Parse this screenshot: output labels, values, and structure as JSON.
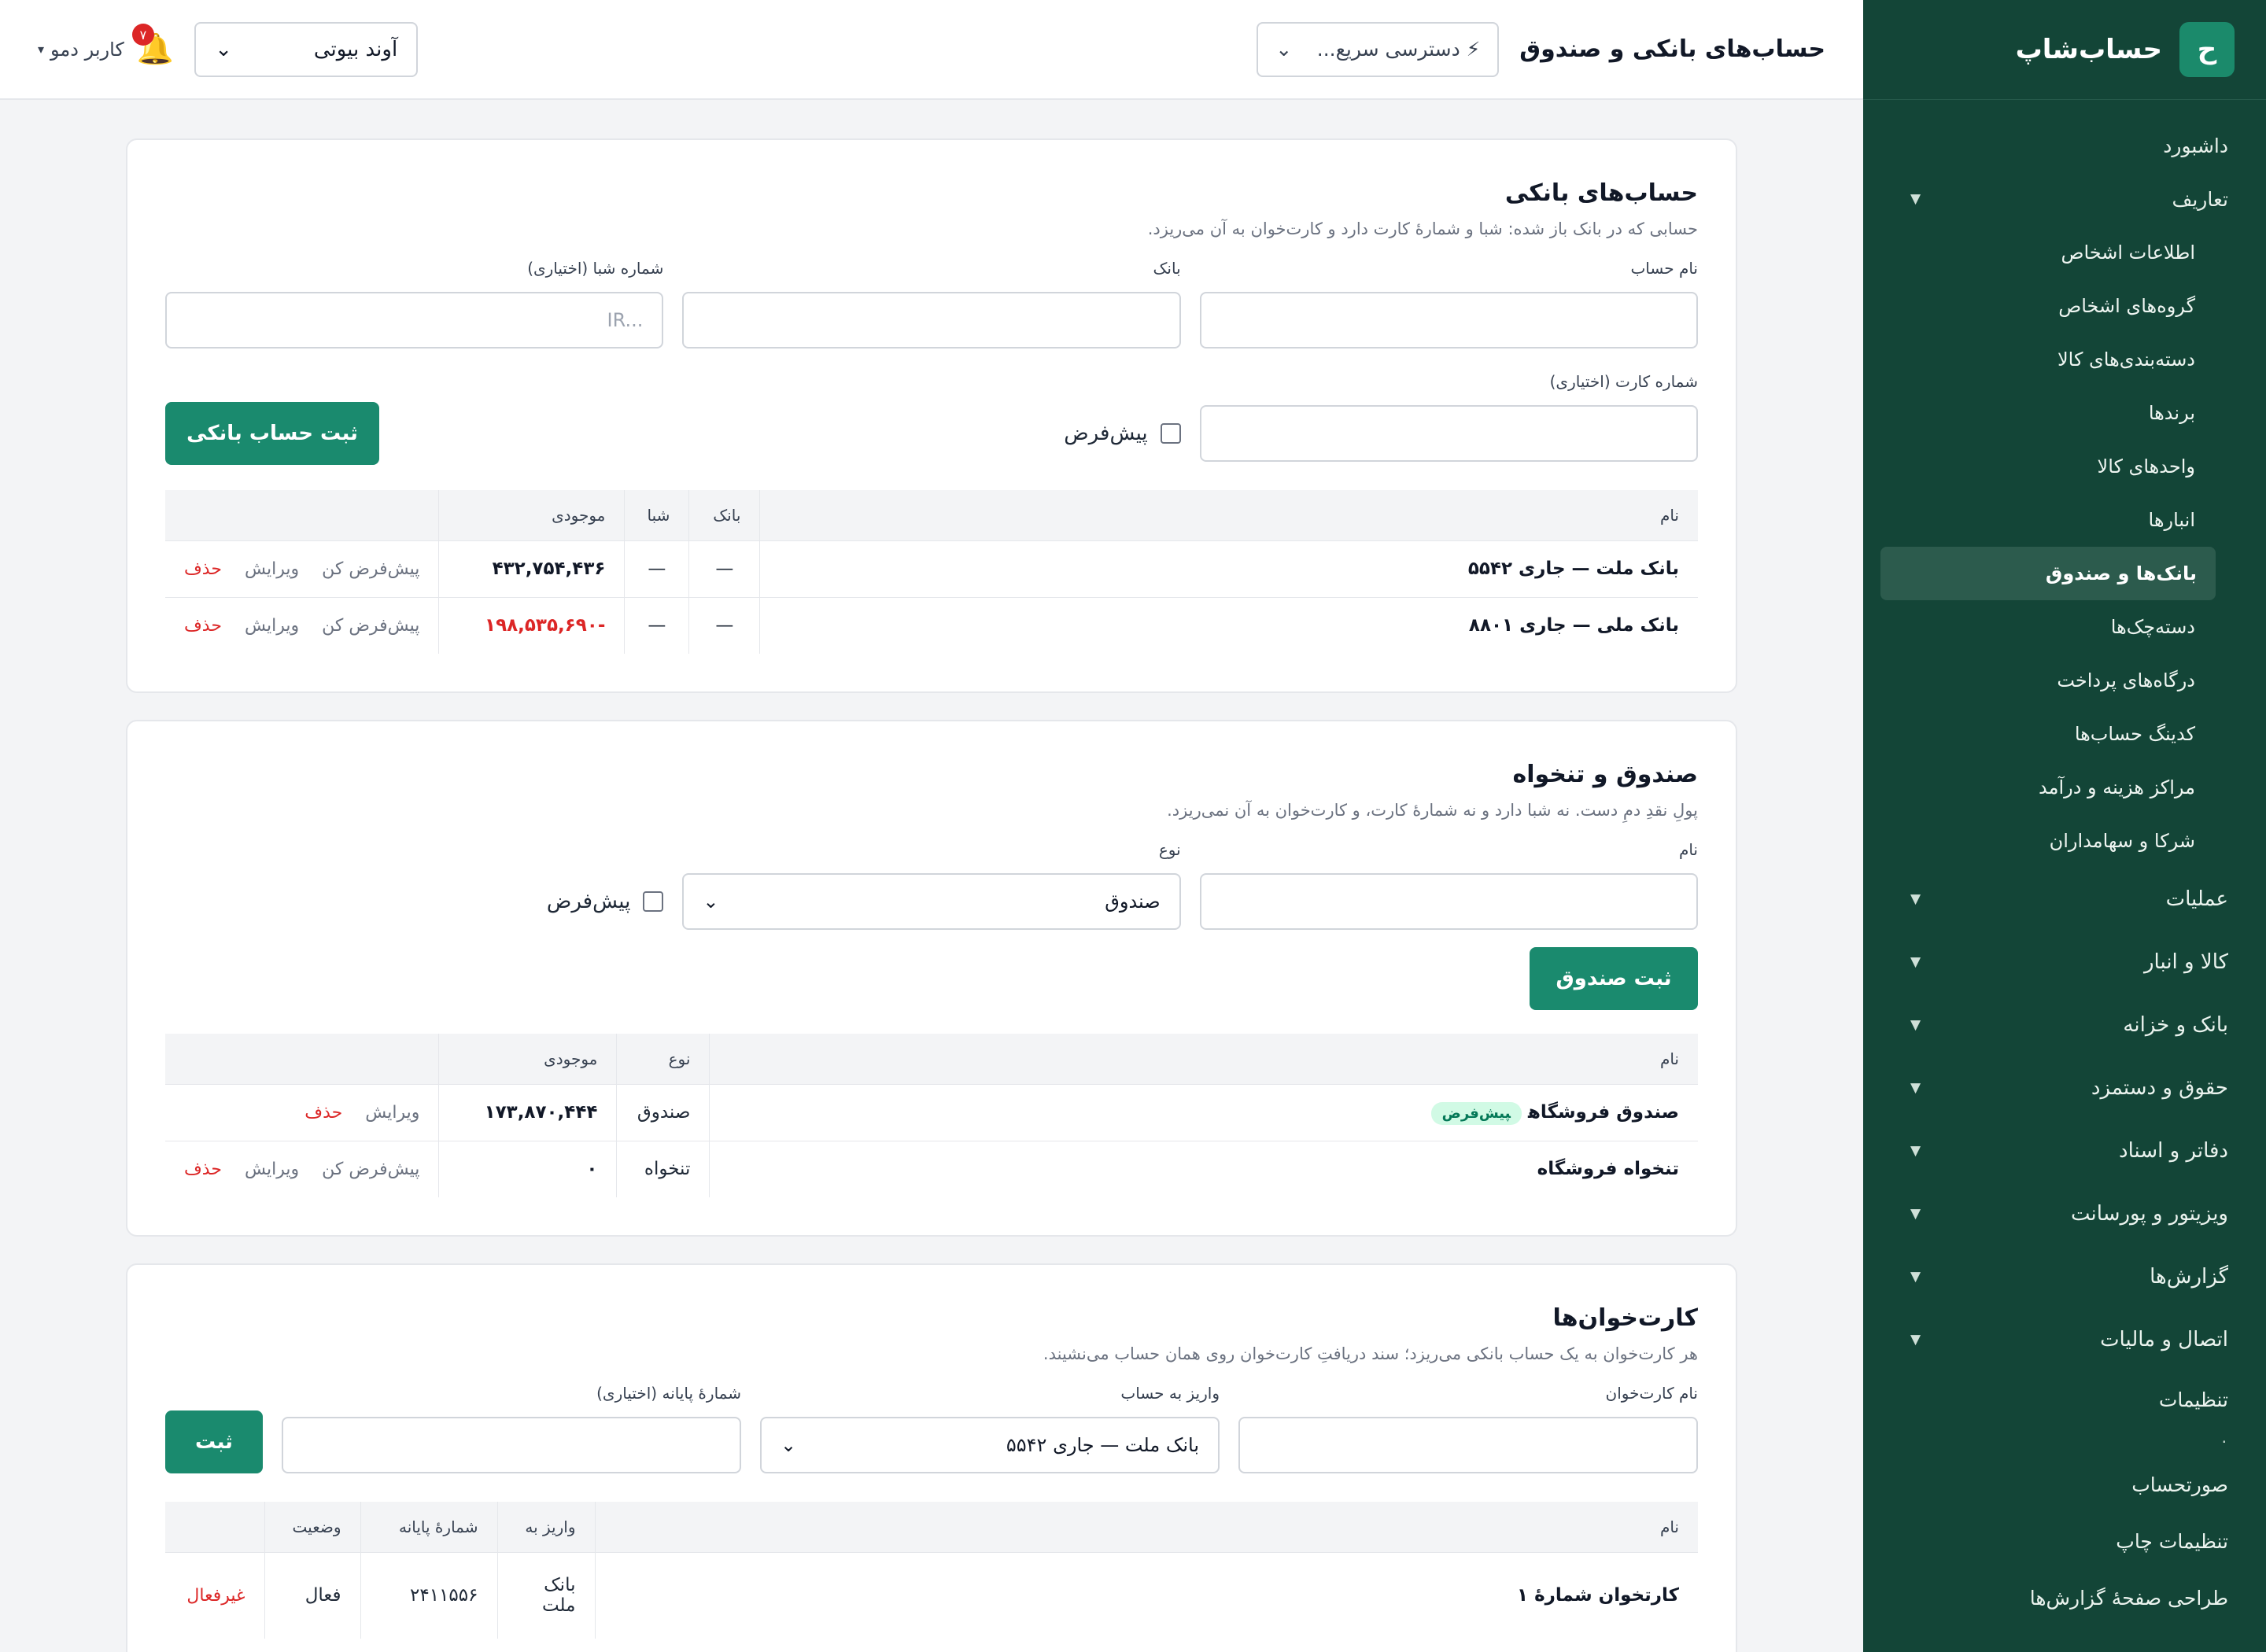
{
  "app": {
    "logo_letter": "ح",
    "name": "حساب‌شاپ"
  },
  "topbar": {
    "title": "حساب‌های بانکی و صندوق",
    "quick_access": "⚡ دسترسی سریع...",
    "branch": "آوند بیوتی",
    "notifications": "۷",
    "user": "کاربر دمو"
  },
  "sidebar": {
    "dashboard": "داشبورد",
    "definitions": "تعاریف",
    "sub": [
      "اطلاعات اشخاص",
      "گروه‌های اشخاص",
      "دسته‌بندی‌های کالا",
      "برندها",
      "واحدهای کالا",
      "انبارها",
      "بانک‌ها و صندوق",
      "دسته‌چک‌ها",
      "درگاه‌های پرداخت",
      "کدینگ حساب‌ها",
      "مراکز هزینه و درآمد",
      "شرکا و سهامداران"
    ],
    "groups": [
      "عملیات",
      "کالا و انبار",
      "بانک و خزانه",
      "حقوق و دستمزد",
      "دفاتر و اسناد",
      "ویزیتور و پورسانت",
      "گزارش‌ها",
      "اتصال و مالیات"
    ],
    "settings": "تنظیمات",
    "dot": "·",
    "tail": [
      "صورتحساب",
      "تنظیمات چاپ",
      "طراحی صفحهٔ گزارش‌ها"
    ]
  },
  "bank": {
    "title": "حساب‌های بانکی",
    "desc": "حسابی که در بانک باز شده: شبا و شمارهٔ کارت دارد و کارت‌خوان به آن می‌ریزد.",
    "label_name": "نام حساب",
    "label_bank": "بانک",
    "label_sheba": "شماره شبا (اختیاری)",
    "sheba_placeholder": "IR...",
    "label_card": "شماره کارت (اختیاری)",
    "default_label": "پیش‌فرض",
    "submit": "ثبت حساب بانکی",
    "columns": [
      "نام",
      "بانک",
      "شبا",
      "موجودی"
    ],
    "rows": [
      {
        "name": "بانک ملت — جاری ۵۵۴۲",
        "bank": "—",
        "sheba": "—",
        "balance": "۴۳۲,۷۵۴,۴۳۶",
        "a1": "پیش‌فرض کن",
        "a2": "ویرایش",
        "a3": "حذف"
      },
      {
        "name": "بانک ملی — جاری ۸۸۰۱",
        "bank": "—",
        "sheba": "—",
        "balance": "-۱۹۸,۵۳۵,۶۹۰",
        "a1": "پیش‌فرض کن",
        "a2": "ویرایش",
        "a3": "حذف"
      }
    ]
  },
  "cash": {
    "title": "صندوق و تنخواه",
    "desc": "پولِ نقدِ دمِ دست. نه شبا دارد و نه شمارهٔ کارت، و کارت‌خوان به آن نمی‌ریزد.",
    "label_name": "نام",
    "label_type": "نوع",
    "type_value": "صندوق",
    "default_label": "پیش‌فرض",
    "submit": "ثبت صندوق",
    "columns": [
      "نام",
      "نوع",
      "موجودی"
    ],
    "rows": [
      {
        "name": "صندوق فروشگاه",
        "tag": "پیش‌فرض",
        "type": "صندوق",
        "balance": "۱۷۳,۸۷۰,۴۴۴",
        "a1": "",
        "a2": "ویرایش",
        "a3": "حذف"
      },
      {
        "name": "تنخواه فروشگاه",
        "tag": "",
        "type": "تنخواه",
        "balance": "۰",
        "a1": "پیش‌فرض کن",
        "a2": "ویرایش",
        "a3": "حذف"
      }
    ]
  },
  "pos": {
    "title": "کارت‌خوان‌ها",
    "desc": "هر کارت‌خوان به یک حساب بانکی می‌ریزد؛ سند دریافتِ کارت‌خوان روی همان حساب می‌نشیند.",
    "label_name": "نام کارت‌خوان",
    "label_account": "واریز به حساب",
    "account_value": "بانک ملت — جاری ۵۵۴۲",
    "label_terminal": "شمارهٔ پایانه (اختیاری)",
    "submit": "ثبت",
    "columns": [
      "نام",
      "واریز به",
      "شمارهٔ پایانه",
      "وضعیت"
    ],
    "row": {
      "name": "کارتخوان شمارهٔ ۱",
      "deposit": "بانک ملت",
      "terminal": "۲۴۱۱۵۵۶",
      "status": "فعال",
      "action": "غیرفعال"
    }
  }
}
